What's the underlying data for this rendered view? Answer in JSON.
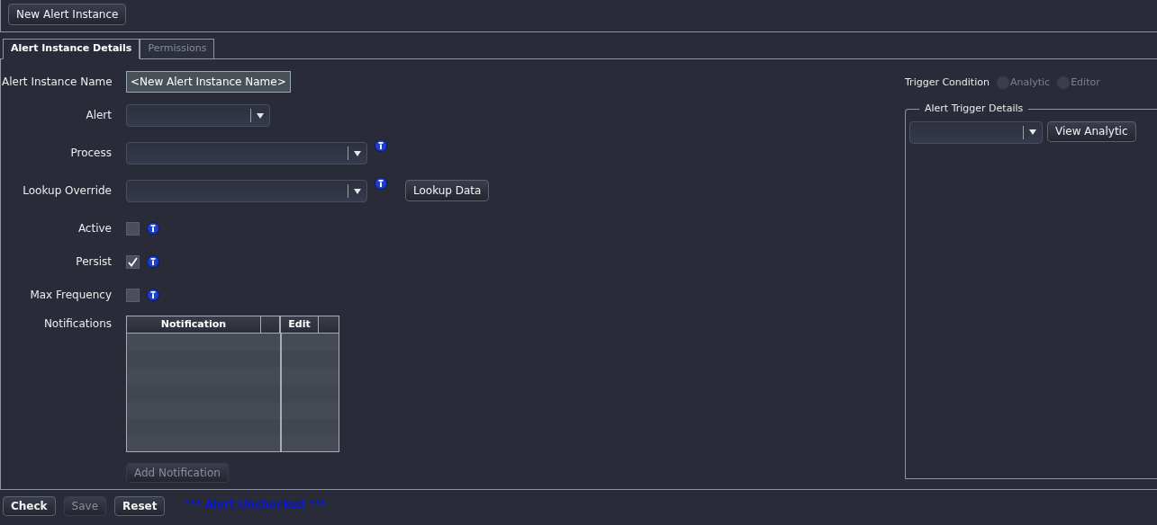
{
  "toolbar": {
    "button": "New Alert Instance"
  },
  "tabs": [
    {
      "label": "Alert Instance Details",
      "selected": true
    },
    {
      "label": "Permissions",
      "selected": false
    }
  ],
  "form": [
    {
      "kind": "text",
      "label": "Alert Instance Name",
      "value": "<New Alert Instance Name>"
    },
    {
      "kind": "dropdown",
      "label": "Alert",
      "info": false
    },
    {
      "kind": "dropdown",
      "label": "Process",
      "info": true
    },
    {
      "kind": "dropdown",
      "label": "Lookup Override",
      "info": true,
      "button": "Lookup Data"
    },
    {
      "kind": "checkbox",
      "label": "Active",
      "checked": false,
      "info": true
    },
    {
      "kind": "checkbox",
      "label": "Persist",
      "checked": true,
      "info": true
    },
    {
      "kind": "checkbox",
      "label": "Max Frequency",
      "checked": false,
      "info": true
    }
  ],
  "notifications": {
    "label": "Notifications",
    "columns": [
      "Notification",
      "Edit"
    ],
    "button": {
      "label": "Add Notification",
      "disabled": true
    }
  },
  "trigger": {
    "label": "Trigger Condition",
    "options": [
      {
        "label": "Analytic",
        "selected": false,
        "disabled": true
      },
      {
        "label": "Editor",
        "selected": false,
        "disabled": true
      }
    ],
    "details": {
      "title": "Alert Trigger Details",
      "button": "View Analytic"
    }
  },
  "footer": {
    "buttons": [
      {
        "label": "Check",
        "disabled": false
      },
      {
        "label": "Save",
        "disabled": true
      },
      {
        "label": "Reset",
        "disabled": false
      }
    ],
    "status": "*** Alert Unchecked ***"
  }
}
